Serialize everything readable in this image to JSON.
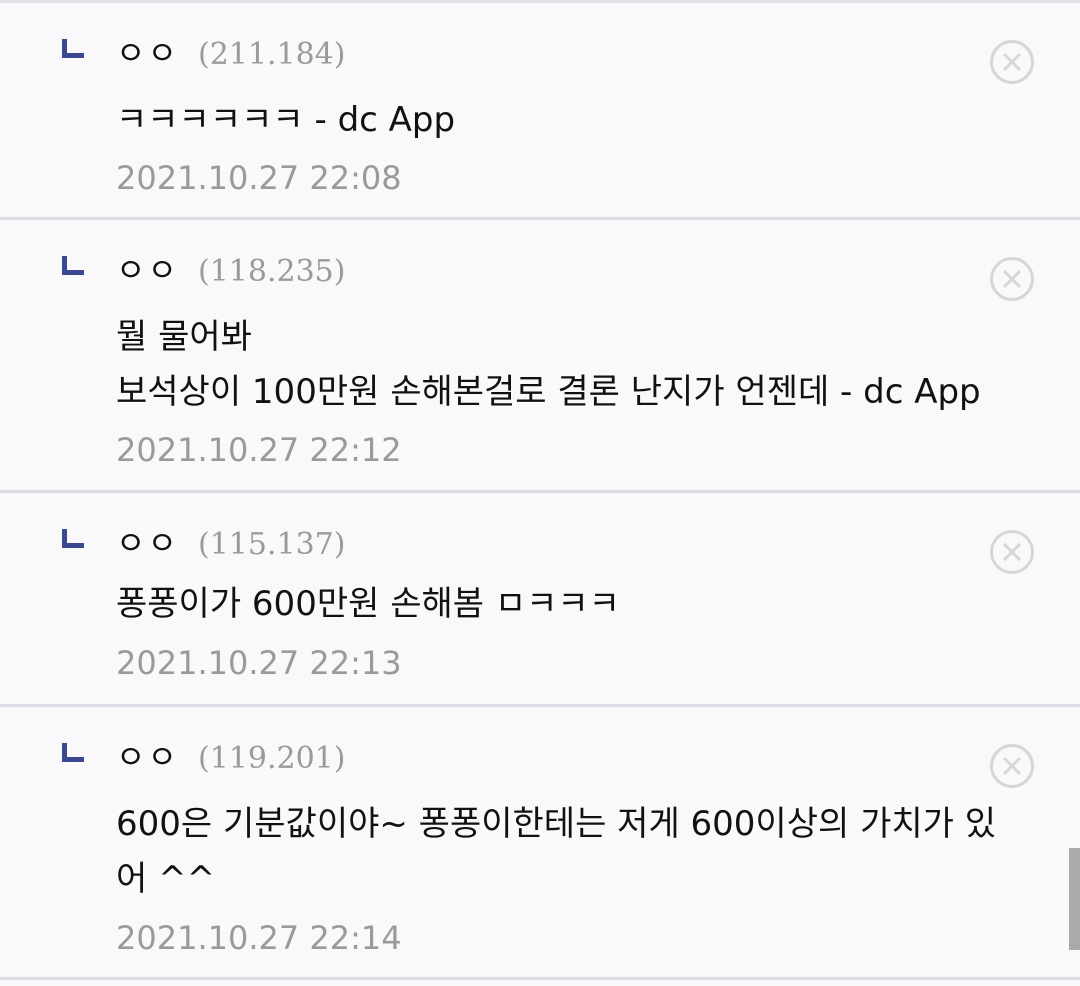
{
  "comments": [
    {
      "nick": "ㅇㅇ",
      "ip": "(211.184)",
      "text": "ㅋㅋㅋㅋㅋㅋ - dc App",
      "date": "2021.10.27 22:08"
    },
    {
      "nick": "ㅇㅇ",
      "ip": "(118.235)",
      "text": "뭘 물어봐\n보석상이 100만원 손해본걸로 결론 난지가 언젠데 - dc App",
      "date": "2021.10.27 22:12"
    },
    {
      "nick": "ㅇㅇ",
      "ip": "(115.137)",
      "text": "퐁퐁이가 600만원 손해봄 ㅁㅋㅋㅋ",
      "date": "2021.10.27 22:13"
    },
    {
      "nick": "ㅇㅇ",
      "ip": "(119.201)",
      "text": "600은 기분값이야~ 퐁퐁이한테는 저게 600이상의 가치가 있\n어 ^^",
      "date": "2021.10.27 22:14"
    }
  ],
  "icons": {
    "reply": "reply-arrow-icon",
    "delete": "close-circle-icon"
  },
  "colors": {
    "background": "#f9f9fb",
    "reply_mark": "#3b4890",
    "meta_text": "#9a9a9a",
    "divider": "#dcdce4"
  }
}
